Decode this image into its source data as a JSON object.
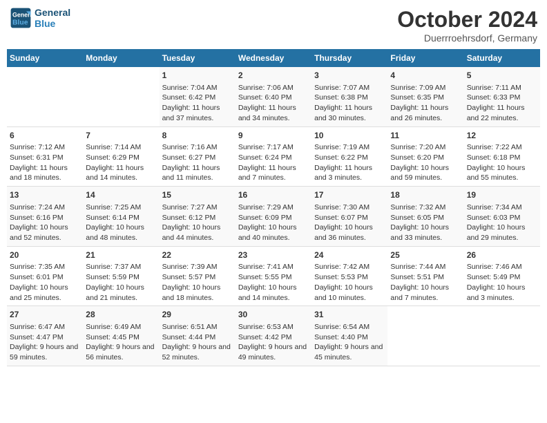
{
  "header": {
    "logo_line1": "General",
    "logo_line2": "Blue",
    "month": "October 2024",
    "location": "Duerrroehrsdorf, Germany"
  },
  "days_of_week": [
    "Sunday",
    "Monday",
    "Tuesday",
    "Wednesday",
    "Thursday",
    "Friday",
    "Saturday"
  ],
  "weeks": [
    [
      {
        "day": "",
        "info": ""
      },
      {
        "day": "",
        "info": ""
      },
      {
        "day": "1",
        "info": "Sunrise: 7:04 AM\nSunset: 6:42 PM\nDaylight: 11 hours and 37 minutes."
      },
      {
        "day": "2",
        "info": "Sunrise: 7:06 AM\nSunset: 6:40 PM\nDaylight: 11 hours and 34 minutes."
      },
      {
        "day": "3",
        "info": "Sunrise: 7:07 AM\nSunset: 6:38 PM\nDaylight: 11 hours and 30 minutes."
      },
      {
        "day": "4",
        "info": "Sunrise: 7:09 AM\nSunset: 6:35 PM\nDaylight: 11 hours and 26 minutes."
      },
      {
        "day": "5",
        "info": "Sunrise: 7:11 AM\nSunset: 6:33 PM\nDaylight: 11 hours and 22 minutes."
      }
    ],
    [
      {
        "day": "6",
        "info": "Sunrise: 7:12 AM\nSunset: 6:31 PM\nDaylight: 11 hours and 18 minutes."
      },
      {
        "day": "7",
        "info": "Sunrise: 7:14 AM\nSunset: 6:29 PM\nDaylight: 11 hours and 14 minutes."
      },
      {
        "day": "8",
        "info": "Sunrise: 7:16 AM\nSunset: 6:27 PM\nDaylight: 11 hours and 11 minutes."
      },
      {
        "day": "9",
        "info": "Sunrise: 7:17 AM\nSunset: 6:24 PM\nDaylight: 11 hours and 7 minutes."
      },
      {
        "day": "10",
        "info": "Sunrise: 7:19 AM\nSunset: 6:22 PM\nDaylight: 11 hours and 3 minutes."
      },
      {
        "day": "11",
        "info": "Sunrise: 7:20 AM\nSunset: 6:20 PM\nDaylight: 10 hours and 59 minutes."
      },
      {
        "day": "12",
        "info": "Sunrise: 7:22 AM\nSunset: 6:18 PM\nDaylight: 10 hours and 55 minutes."
      }
    ],
    [
      {
        "day": "13",
        "info": "Sunrise: 7:24 AM\nSunset: 6:16 PM\nDaylight: 10 hours and 52 minutes."
      },
      {
        "day": "14",
        "info": "Sunrise: 7:25 AM\nSunset: 6:14 PM\nDaylight: 10 hours and 48 minutes."
      },
      {
        "day": "15",
        "info": "Sunrise: 7:27 AM\nSunset: 6:12 PM\nDaylight: 10 hours and 44 minutes."
      },
      {
        "day": "16",
        "info": "Sunrise: 7:29 AM\nSunset: 6:09 PM\nDaylight: 10 hours and 40 minutes."
      },
      {
        "day": "17",
        "info": "Sunrise: 7:30 AM\nSunset: 6:07 PM\nDaylight: 10 hours and 36 minutes."
      },
      {
        "day": "18",
        "info": "Sunrise: 7:32 AM\nSunset: 6:05 PM\nDaylight: 10 hours and 33 minutes."
      },
      {
        "day": "19",
        "info": "Sunrise: 7:34 AM\nSunset: 6:03 PM\nDaylight: 10 hours and 29 minutes."
      }
    ],
    [
      {
        "day": "20",
        "info": "Sunrise: 7:35 AM\nSunset: 6:01 PM\nDaylight: 10 hours and 25 minutes."
      },
      {
        "day": "21",
        "info": "Sunrise: 7:37 AM\nSunset: 5:59 PM\nDaylight: 10 hours and 21 minutes."
      },
      {
        "day": "22",
        "info": "Sunrise: 7:39 AM\nSunset: 5:57 PM\nDaylight: 10 hours and 18 minutes."
      },
      {
        "day": "23",
        "info": "Sunrise: 7:41 AM\nSunset: 5:55 PM\nDaylight: 10 hours and 14 minutes."
      },
      {
        "day": "24",
        "info": "Sunrise: 7:42 AM\nSunset: 5:53 PM\nDaylight: 10 hours and 10 minutes."
      },
      {
        "day": "25",
        "info": "Sunrise: 7:44 AM\nSunset: 5:51 PM\nDaylight: 10 hours and 7 minutes."
      },
      {
        "day": "26",
        "info": "Sunrise: 7:46 AM\nSunset: 5:49 PM\nDaylight: 10 hours and 3 minutes."
      }
    ],
    [
      {
        "day": "27",
        "info": "Sunrise: 6:47 AM\nSunset: 4:47 PM\nDaylight: 9 hours and 59 minutes."
      },
      {
        "day": "28",
        "info": "Sunrise: 6:49 AM\nSunset: 4:45 PM\nDaylight: 9 hours and 56 minutes."
      },
      {
        "day": "29",
        "info": "Sunrise: 6:51 AM\nSunset: 4:44 PM\nDaylight: 9 hours and 52 minutes."
      },
      {
        "day": "30",
        "info": "Sunrise: 6:53 AM\nSunset: 4:42 PM\nDaylight: 9 hours and 49 minutes."
      },
      {
        "day": "31",
        "info": "Sunrise: 6:54 AM\nSunset: 4:40 PM\nDaylight: 9 hours and 45 minutes."
      },
      {
        "day": "",
        "info": ""
      },
      {
        "day": "",
        "info": ""
      }
    ]
  ]
}
